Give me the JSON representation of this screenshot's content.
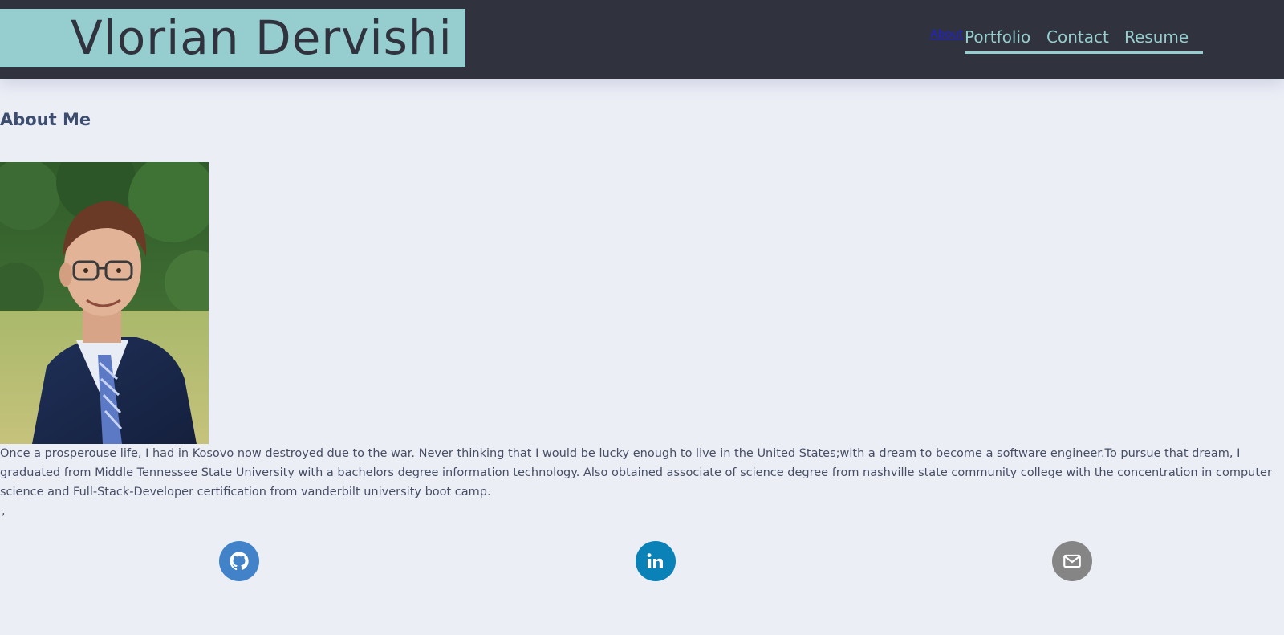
{
  "header": {
    "brand_name": "Vlorian Dervishi",
    "nav": {
      "about": "About",
      "portfolio": "Portfolio",
      "contact": "Contact",
      "resume": "Resume"
    }
  },
  "about": {
    "title": "About Me",
    "bio": "Once a prosperouse life, I had in Kosovo now destroyed due to the war. Never thinking that I would be lucky enough to live in the United States;with a dream to become a software engineer.To pursue that dream, I graduated from Middle Tennessee State University with a bachelors degree information technology. Also obtained associate of science degree from nashville state community college with the concentration in computer science and Full-Stack-Developer certification from vanderbilt university boot camp.",
    "stray_text": ","
  },
  "social": [
    {
      "icon": "github-icon",
      "color": "#4182c8"
    },
    {
      "icon": "linkedin-icon",
      "color": "#0a81b7"
    },
    {
      "icon": "mail-icon",
      "color": "#858585"
    }
  ]
}
